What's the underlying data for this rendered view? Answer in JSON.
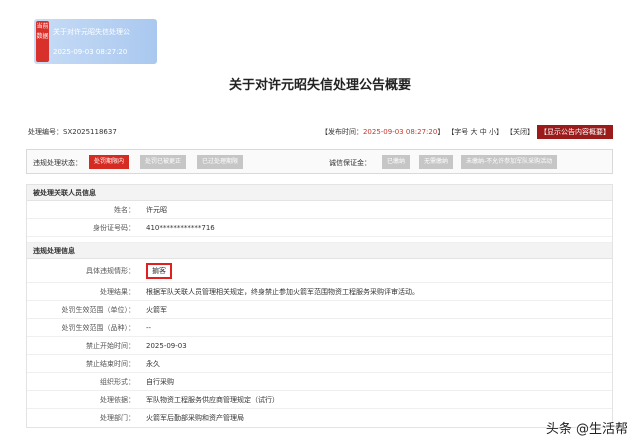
{
  "banner": {
    "badge": "当前数据",
    "title": "关于对许元昭失信处理公",
    "time": "2025-09-03 08:27:20"
  },
  "page_title": "关于对许元昭失信处理公告概要",
  "meta": {
    "serial": "处理编号：SX2025118637",
    "publish_label": "【发布时间：",
    "publish_time": "2025-09-03 08:27:20",
    "publish_end": "】",
    "font_size": "【字号 大 中 小】",
    "close": "【关闭】",
    "show_content": "【显示公告内容概要】"
  },
  "status": {
    "violation_label": "违规处理状态：",
    "violation_buttons": [
      "处罚期限内",
      "处罚已被更正",
      "已过处理期限"
    ],
    "integrity_label": "诚信保证金：",
    "integrity_buttons": [
      "已缴纳",
      "无需缴纳",
      "未缴纳-不允许参加军队采购活动"
    ]
  },
  "sections": [
    {
      "title": "被处理关联人员信息",
      "rows": [
        {
          "label": "姓名：",
          "value": "许元昭"
        },
        {
          "label": "身份证号码：",
          "value": "410************716"
        }
      ]
    },
    {
      "title": "违规处理信息",
      "rows": [
        {
          "label": "具体违规情形：",
          "value": "掮客"
        },
        {
          "label": "处理结果：",
          "value": "根据军队关联人员管理相关规定，终身禁止参加火箭军范围物资工程服务采购评审活动。"
        },
        {
          "label": "处罚生效范围（单位）：",
          "value": "火箭军"
        },
        {
          "label": "处罚生效范围（品种）：",
          "value": "--"
        },
        {
          "label": "禁止开始时间：",
          "value": "2025-09-03"
        },
        {
          "label": "禁止结束时间：",
          "value": "永久"
        },
        {
          "label": "组织形式：",
          "value": "自行采购"
        },
        {
          "label": "处理依据：",
          "value": "军队物资工程服务供应商管理规定（试行）"
        },
        {
          "label": "处理部门：",
          "value": "火箭军后勤部采购和资产管理局"
        }
      ]
    }
  ],
  "watermark": "头条 @生活帮"
}
